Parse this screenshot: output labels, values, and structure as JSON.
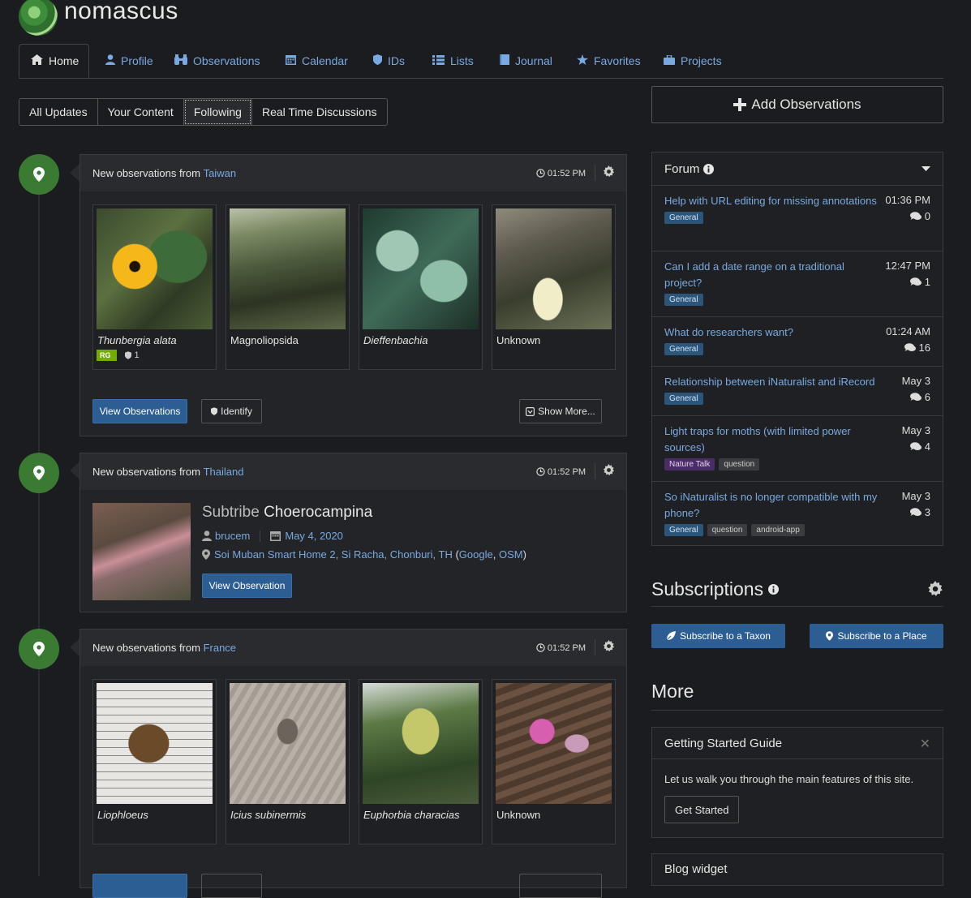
{
  "site": {
    "name": "nomascus"
  },
  "nav": {
    "tabs": [
      {
        "label": "Home",
        "icon": "home-icon"
      },
      {
        "label": "Profile",
        "icon": "user-icon"
      },
      {
        "label": "Observations",
        "icon": "binoculars-icon"
      },
      {
        "label": "Calendar",
        "icon": "calendar-icon"
      },
      {
        "label": "IDs",
        "icon": "shield-icon"
      },
      {
        "label": "Lists",
        "icon": "list-icon"
      },
      {
        "label": "Journal",
        "icon": "book-icon"
      },
      {
        "label": "Favorites",
        "icon": "star-icon"
      },
      {
        "label": "Projects",
        "icon": "briefcase-icon"
      }
    ]
  },
  "subtabs": [
    "All Updates",
    "Your Content",
    "Following",
    "Real Time Discussions"
  ],
  "feed": [
    {
      "prefix": "New observations from",
      "place": "Taiwan",
      "time": "01:52 PM",
      "items": [
        {
          "name": "Thunbergia alata",
          "italic": true,
          "rg": "RG",
          "ids": "1"
        },
        {
          "name": "Magnoliopsida",
          "italic": false
        },
        {
          "name": "Dieffenbachia",
          "italic": true
        },
        {
          "name": "Unknown",
          "italic": false
        }
      ],
      "view_label": "View Observations",
      "identify_label": "Identify",
      "more_label": "Show More..."
    },
    {
      "prefix": "New observations from",
      "place": "Thailand",
      "time": "01:52 PM",
      "rank": "Subtribe",
      "taxon": "Choerocampina",
      "user": "brucem",
      "date": "May 4, 2020",
      "location": "Soi Muban Smart Home 2, Si Racha, Chonburi, TH",
      "map1": "Google",
      "map2": "OSM",
      "view_label": "View Observation"
    },
    {
      "prefix": "New observations from",
      "place": "France",
      "time": "01:52 PM",
      "items": [
        {
          "name": "Liophloeus",
          "italic": true
        },
        {
          "name": "Icius subinermis",
          "italic": true
        },
        {
          "name": "Euphorbia characias",
          "italic": true
        },
        {
          "name": "Unknown",
          "italic": false
        }
      ]
    }
  ],
  "add_obs": "Add Observations",
  "forum": {
    "title": "Forum",
    "items": [
      {
        "title": "Help with URL editing for missing annotations",
        "time": "01:36 PM",
        "replies": "0",
        "tags": [
          {
            "label": "General",
            "kind": "general"
          }
        ]
      },
      {
        "title": "Can I add a date range on a traditional project?",
        "time": "12:47 PM",
        "replies": "1",
        "tags": [
          {
            "label": "General",
            "kind": "general"
          }
        ]
      },
      {
        "title": "What do researchers want?",
        "time": "01:24 AM",
        "replies": "16",
        "tags": [
          {
            "label": "General",
            "kind": "general"
          }
        ]
      },
      {
        "title": "Relationship between iNaturalist and iRecord",
        "time": "May 3",
        "replies": "6",
        "tags": [
          {
            "label": "General",
            "kind": "general"
          }
        ]
      },
      {
        "title": "Light traps for moths (with limited power sources)",
        "time": "May 3",
        "replies": "4",
        "tags": [
          {
            "label": "Nature Talk",
            "kind": "nature"
          },
          {
            "label": "question",
            "kind": "q"
          }
        ]
      },
      {
        "title": "So iNaturalist is no longer compatible with my phone?",
        "time": "May 3",
        "replies": "3",
        "tags": [
          {
            "label": "General",
            "kind": "general"
          },
          {
            "label": "question",
            "kind": "q"
          },
          {
            "label": "android-app",
            "kind": "q"
          }
        ]
      }
    ]
  },
  "subscriptions": {
    "title": "Subscriptions",
    "taxon_label": "Subscribe to a Taxon",
    "place_label": "Subscribe to a Place"
  },
  "more": {
    "title": "More",
    "guide_title": "Getting Started Guide",
    "guide_text": "Let us walk you through the main features of this site.",
    "guide_button": "Get Started",
    "blog_title": "Blog widget"
  },
  "colors": {
    "background": "#1b1c1f",
    "link": "#79a9e0",
    "primary_button": "#2c5d93",
    "pin": "#3b7a32"
  }
}
